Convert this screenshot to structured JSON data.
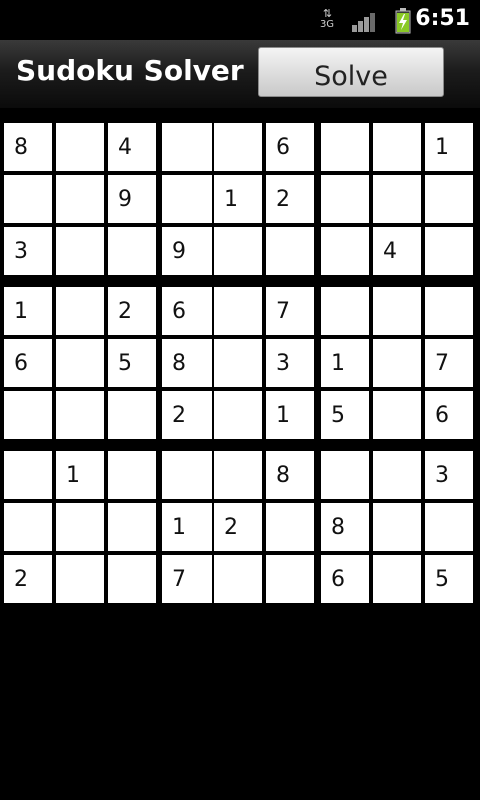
{
  "status_bar": {
    "network_type": "3G",
    "network_icon": "data-transfer-icon",
    "signal_icon": "signal-strength-icon",
    "battery_icon": "battery-charging-icon",
    "time": "6:51"
  },
  "app": {
    "title": "Sudoku Solver",
    "solve_label": "Solve"
  },
  "grid": [
    [
      "8",
      "",
      "4",
      "",
      "",
      "6",
      "",
      "",
      "1"
    ],
    [
      "",
      "",
      "9",
      "",
      "1",
      "2",
      "",
      "",
      ""
    ],
    [
      "3",
      "",
      "",
      "9",
      "",
      "",
      "",
      "4",
      ""
    ],
    [
      "1",
      "",
      "2",
      "6",
      "",
      "7",
      "",
      "",
      ""
    ],
    [
      "6",
      "",
      "5",
      "8",
      "",
      "3",
      "1",
      "",
      "7"
    ],
    [
      "",
      "",
      "",
      "2",
      "",
      "1",
      "5",
      "",
      "6"
    ],
    [
      "",
      "1",
      "",
      "",
      "",
      "8",
      "",
      "",
      "3"
    ],
    [
      "",
      "",
      "",
      "1",
      "2",
      "",
      "8",
      "",
      ""
    ],
    [
      "2",
      "",
      "",
      "7",
      "",
      "",
      "6",
      "",
      "5"
    ]
  ],
  "colors": {
    "background": "#000000",
    "cell": "#ffffff",
    "text": "#111111"
  }
}
